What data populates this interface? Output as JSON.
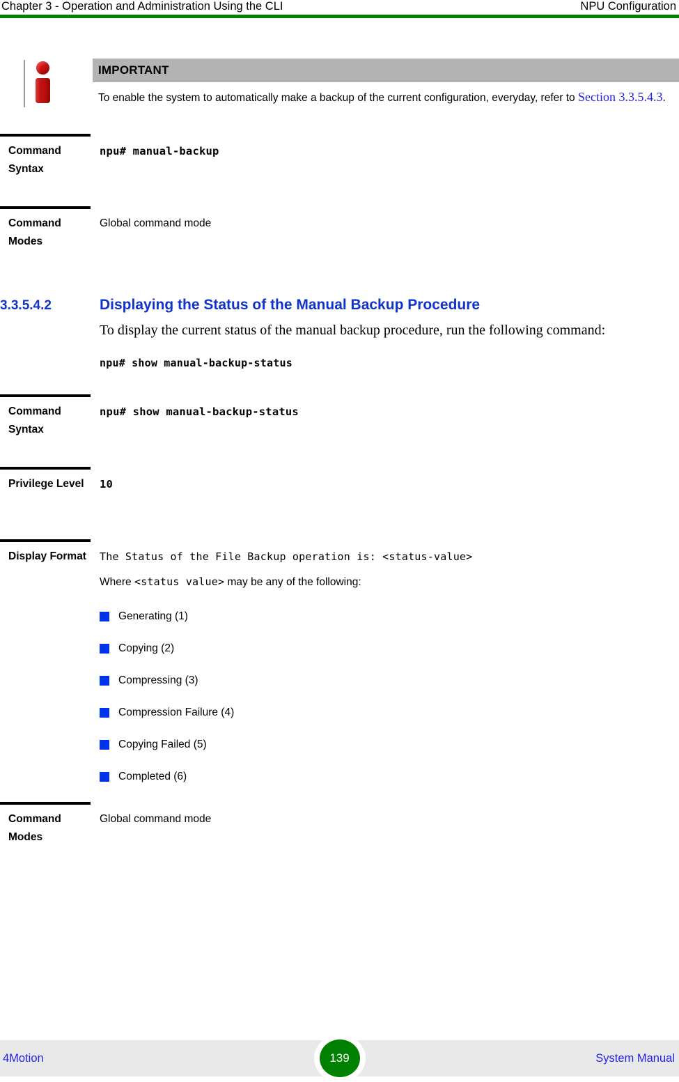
{
  "header": {
    "left": "Chapter 3 - Operation and Administration Using the CLI",
    "right": "NPU Configuration",
    "rule_color": "#008000"
  },
  "admonition": {
    "icon": "info-icon",
    "title": "IMPORTANT",
    "text_before_link": "To enable the system to automatically make a backup of the current configuration, everyday, refer to ",
    "link_text": "Section 3.3.5.4.3",
    "text_after_link": ".",
    "title_bar_color": "#b3b3b3",
    "link_color": "#2222ee"
  },
  "rows": [
    {
      "label": "Command Syntax",
      "value": "npu# manual-backup",
      "value_style": "mono-bold"
    },
    {
      "label": "Command Modes",
      "value": "Global command mode",
      "value_style": "sans"
    }
  ],
  "section": {
    "number": "3.3.5.4.2",
    "title": "Displaying the Status of the Manual Backup Procedure",
    "color": "#1133cc",
    "paragraph": "To display the current status of the manual backup procedure, run the following command:",
    "command": "npu# show manual-backup-status"
  },
  "rows2": [
    {
      "label": "Command Syntax",
      "value": "npu# show manual-backup-status",
      "value_style": "mono-bold"
    },
    {
      "label": "Privilege Level",
      "value": "10",
      "value_style": "mono-bold"
    }
  ],
  "display_format": {
    "label": "Display Format",
    "output_line": "The Status of the File Backup operation is: <status-value>",
    "where_prefix": "Where ",
    "where_mono": "<status value>",
    "where_suffix": " may be any of the following:",
    "bullet_color": "#0033ee",
    "status_values": [
      "Generating (1)",
      "Copying (2)",
      "Compressing (3)",
      "Compression Failure (4)",
      "Copying Failed (5)",
      "Completed (6)"
    ]
  },
  "rows3": [
    {
      "label": "Command Modes",
      "value": "Global command mode",
      "value_style": "sans"
    }
  ],
  "footer": {
    "left": "4Motion",
    "page_number": "139",
    "right": "System Manual",
    "badge_color": "#008000",
    "band_color": "#e9e9e9",
    "text_color": "#2222ee"
  }
}
